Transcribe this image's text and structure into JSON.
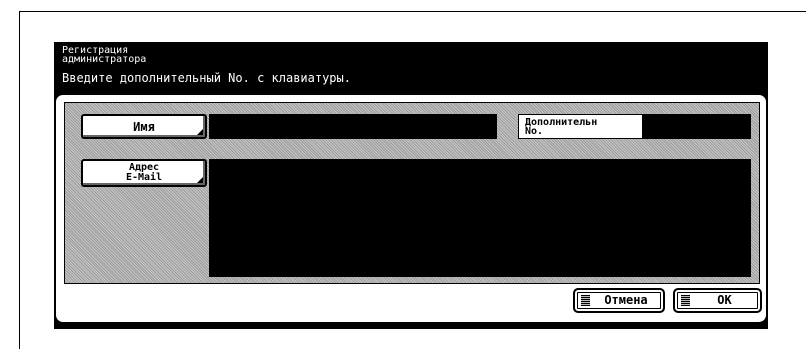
{
  "header": {
    "title": "Регистрация\nадминистратора",
    "instruction": "Введите дополнительный No. с клавиатуры."
  },
  "form": {
    "name_button": "Имя",
    "email_button": "Адрес\nE-Mail",
    "extension_label": "Дополнительн\nNo.",
    "name_value": "",
    "extension_value": "",
    "email_value": ""
  },
  "footer": {
    "cancel_label": "Отмена",
    "ok_label": "OK"
  },
  "colors": {
    "screen_bg": "#000000",
    "panel_bg": "#ffffff",
    "dither": "#9a9a9a"
  }
}
